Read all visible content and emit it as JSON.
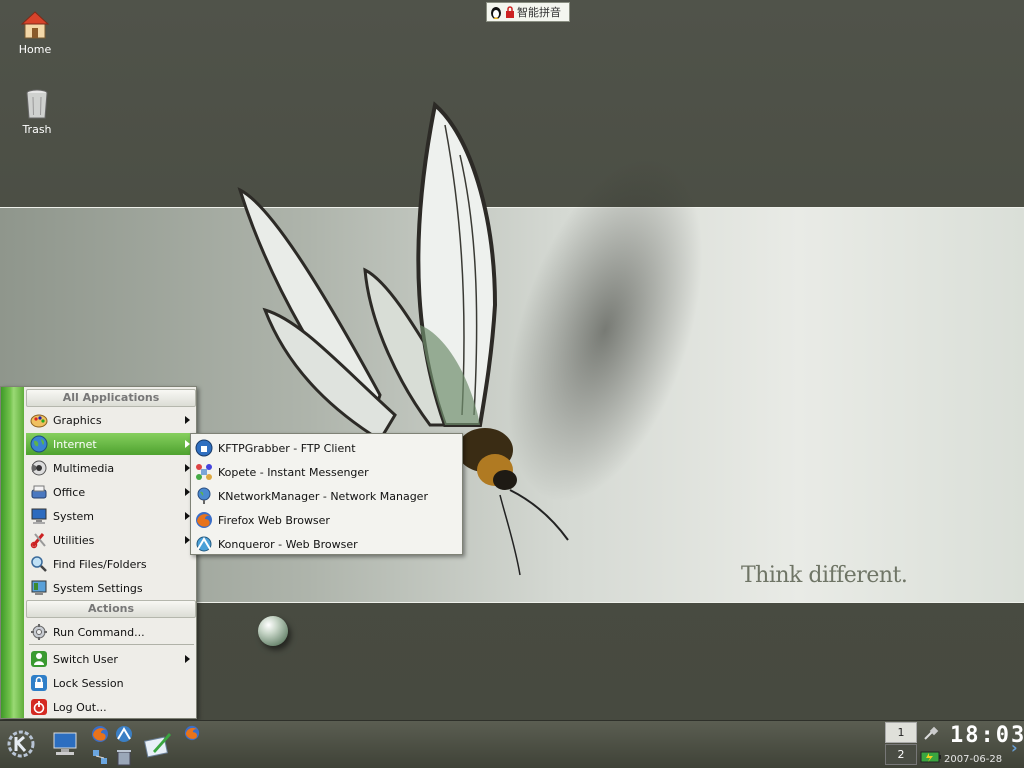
{
  "desktop": {
    "icons": [
      {
        "label": "Home",
        "icon": "home-icon"
      },
      {
        "label": "Trash",
        "icon": "trash-icon"
      }
    ],
    "slogan": "Think different."
  },
  "ime_indicator": {
    "label": "智能拼音"
  },
  "kmenu": {
    "header_all": "All Applications",
    "items": [
      {
        "label": "Graphics",
        "icon": "graphics-icon",
        "submenu": true
      },
      {
        "label": "Internet",
        "icon": "internet-icon",
        "submenu": true,
        "active": true
      },
      {
        "label": "Multimedia",
        "icon": "multimedia-icon",
        "submenu": true
      },
      {
        "label": "Office",
        "icon": "office-icon",
        "submenu": true
      },
      {
        "label": "System",
        "icon": "system-icon",
        "submenu": true
      },
      {
        "label": "Utilities",
        "icon": "utilities-icon",
        "submenu": true
      },
      {
        "label": "Find Files/Folders",
        "icon": "find-icon",
        "submenu": false
      },
      {
        "label": "System Settings",
        "icon": "settings-icon",
        "submenu": false
      }
    ],
    "header_actions": "Actions",
    "actions": [
      {
        "label": "Run Command...",
        "icon": "run-icon",
        "submenu": false
      },
      {
        "label": "Switch User",
        "icon": "switch-user-icon",
        "submenu": true
      },
      {
        "label": "Lock Session",
        "icon": "lock-icon",
        "submenu": false
      },
      {
        "label": "Log Out...",
        "icon": "logout-icon",
        "submenu": false
      }
    ]
  },
  "internet_submenu": [
    {
      "label": "KFTPGrabber - FTP Client",
      "icon": "ftp-icon"
    },
    {
      "label": "Kopete - Instant Messenger",
      "icon": "kopete-icon"
    },
    {
      "label": "KNetworkManager - Network Manager",
      "icon": "network-icon"
    },
    {
      "label": "Firefox Web Browser",
      "icon": "firefox-icon"
    },
    {
      "label": "Konqueror - Web Browser",
      "icon": "konqueror-icon"
    }
  ],
  "taskbar": {
    "pager": [
      "1",
      "2"
    ],
    "clock_time": "18:03",
    "clock_date": "2007-06-28",
    "more": "›"
  },
  "colors": {
    "menu_accent": "#5fb43c",
    "menu_bg": "#eeede8"
  }
}
